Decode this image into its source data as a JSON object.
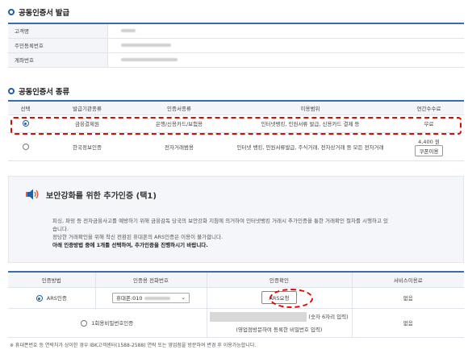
{
  "issue_section": {
    "title": "공동인증서 발급",
    "rows": [
      {
        "label": "고객명"
      },
      {
        "label": "주민등록번호"
      },
      {
        "label": "계좌번호"
      }
    ]
  },
  "cert_section": {
    "title": "공동인증서 종류",
    "headers": [
      "선택",
      "발급기관종류",
      "인증서종류",
      "이용범위",
      "연간수수료"
    ],
    "rows": [
      {
        "agency": "금융결제원",
        "type": "은행/신용카드/보험용",
        "scope": "인터넷뱅킹, 민원서류 발급, 신용카드 결제 등",
        "fee": "무료",
        "selected": true
      },
      {
        "agency": "한국정보인증",
        "type": "전자거래범용",
        "scope": "인터넷 뱅킹, 민원서류발급, 주식거래, 전자상거래 등 모든 전자거래",
        "fee": "4,400 원",
        "coupon": "쿠폰이용",
        "selected": false
      }
    ]
  },
  "additional_auth": {
    "title": "보안강화를 위한 추가인증 (택1)",
    "desc_line1": "피싱, 파밍 등 전자금융사고를 예방하기 위해 금융감독 당국의 보안강화 지침에 의거하여 인터넷뱅킹 거래시 추가인증을 통한 거래확인 절차를 시행하고 있",
    "desc_line2": "습니다.",
    "desc_line3": "정당한 거래확인을 위해 착신 전환된 휴대폰의 ARS인증은 이용이 불가합니다.",
    "desc_bold": "아래 인증방법 중에 1개를 선택하여, 추가인증을 진행하시기 바랍니다."
  },
  "auth_table": {
    "headers": [
      "인증방법",
      "인증용 전화번호",
      "인증확인",
      "서비스이용료"
    ],
    "ars": {
      "label": "ARS인증",
      "phone_prefix": "휴대폰:010",
      "button": "ARS요청",
      "fee": "없음",
      "selected": true
    },
    "pw": {
      "label": "1회용비밀번호인증",
      "hint1": "(숫자 6자리 입력)",
      "hint2": "(영업점방문하여 등록한 비밀번호 입력)",
      "fee": "없음",
      "selected": false
    }
  },
  "footnote": "※ 휴대폰번호 등 연락처가 상이한 경우 IBK고객센터(1588-2588) 연락 또는 영업점을 방문하여 변경 후 이용가능합니다.",
  "colors": {
    "accent": "#1f5fae",
    "highlight": "#e00000"
  }
}
